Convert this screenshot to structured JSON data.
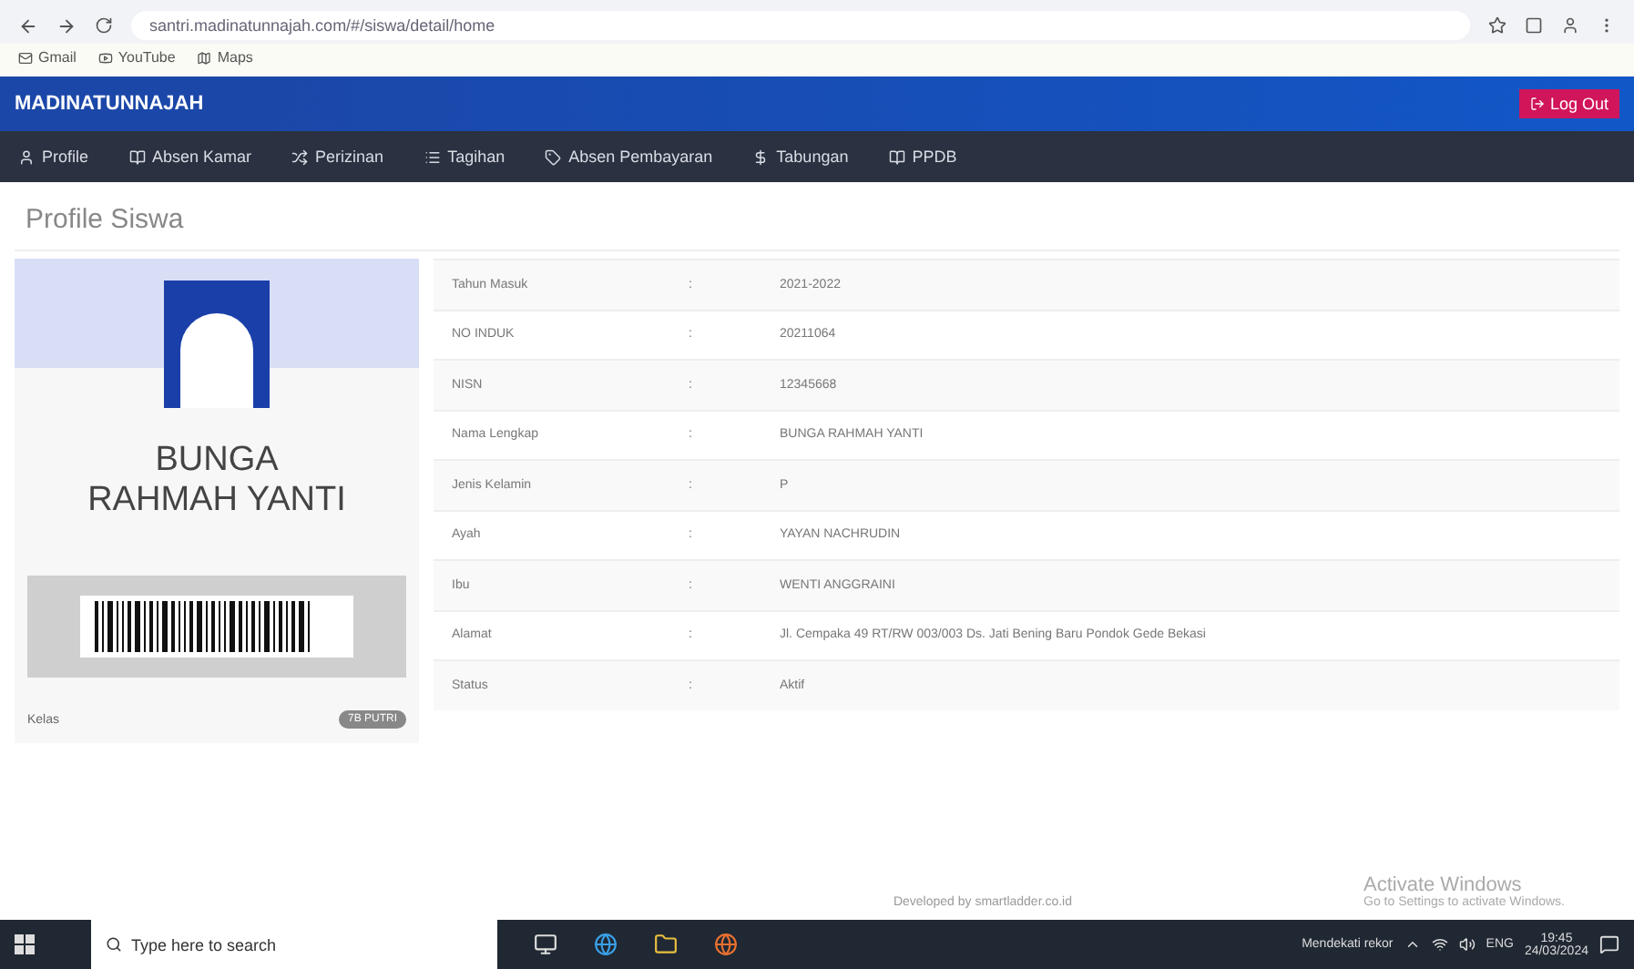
{
  "browser": {
    "url": "santri.madinatunnajah.com/#/siswa/detail/home",
    "bookmarks": [
      "Gmail",
      "YouTube",
      "Maps"
    ]
  },
  "app": {
    "brand": "MADINATUNNAJAH",
    "logout": "Log Out"
  },
  "menu": [
    {
      "label": "Profile",
      "kind": "user"
    },
    {
      "label": "Absen Kamar",
      "kind": "book"
    },
    {
      "label": "Perizinan",
      "kind": "shuffle"
    },
    {
      "label": "Tagihan",
      "kind": "list"
    },
    {
      "label": "Absen Pembayaran",
      "kind": "tag"
    },
    {
      "label": "Tabungan",
      "kind": "dollar"
    },
    {
      "label": "PPDB",
      "kind": "book"
    }
  ],
  "page_title": "Profile Siswa",
  "card": {
    "name": "BUNGA RAHMAH YANTI",
    "class_label": "Kelas",
    "class_badge": "7B PUTRI"
  },
  "details": [
    {
      "label": "Tahun Masuk",
      "separator": ":",
      "value": "2021-2022"
    },
    {
      "label": "NO INDUK",
      "separator": ":",
      "value": "20211064"
    },
    {
      "label": "NISN",
      "separator": ":",
      "value": "12345668"
    },
    {
      "label": "Nama Lengkap",
      "separator": ":",
      "value": "BUNGA RAHMAH YANTI"
    },
    {
      "label": "Jenis Kelamin",
      "separator": ":",
      "value": "P"
    },
    {
      "label": "Ayah",
      "separator": ":",
      "value": "YAYAN NACHRUDIN"
    },
    {
      "label": "Ibu",
      "separator": ":",
      "value": "WENTI ANGGRAINI"
    },
    {
      "label": "Alamat",
      "separator": ":",
      "value": "Jl. Cempaka 49 RT/RW 003/003 Ds. Jati Bening Baru Pondok Gede Bekasi"
    },
    {
      "label": "Status",
      "separator": ":",
      "value": "Aktif"
    }
  ],
  "footer": "Developed by smartladder.co.id",
  "activation": {
    "title": "Activate Windows",
    "hint": "Go to Settings to activate Windows."
  },
  "taskbar": {
    "search_placeholder": "Type here to search",
    "weather": "Mendekati rekor",
    "language": "ENG",
    "time": "19:45",
    "date": "24/03/2024"
  }
}
